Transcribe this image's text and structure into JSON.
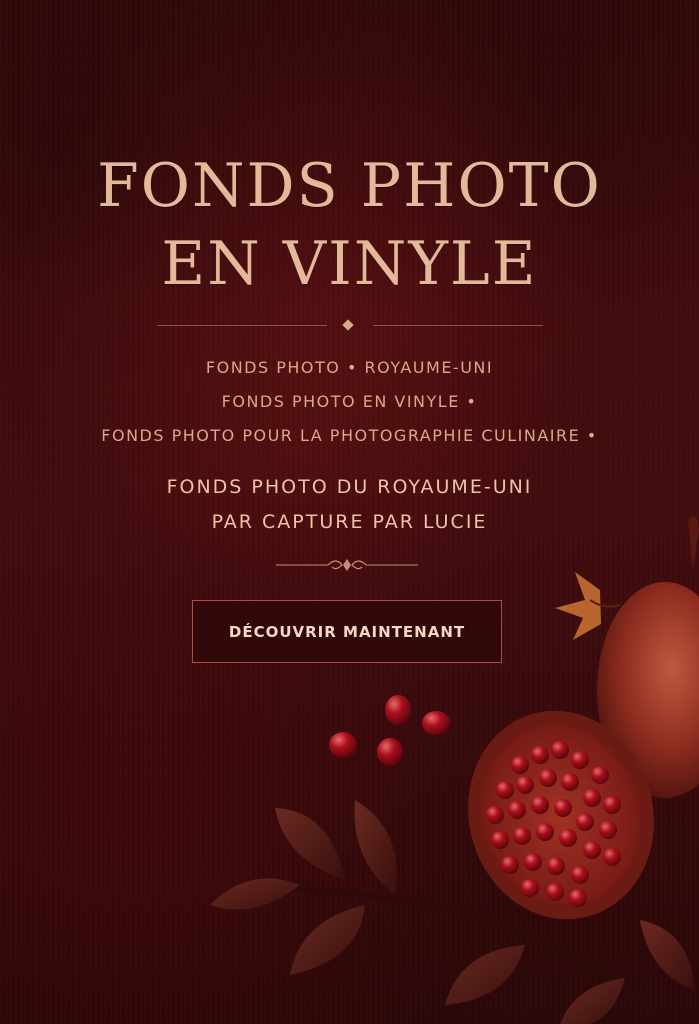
{
  "hero": {
    "title_line1": "FONDS PHOTO",
    "title_line2": "EN VINYLE",
    "subtitle_lines": [
      "FONDS PHOTO • ROYAUME-UNI",
      "FONDS PHOTO EN VINYLE •",
      "FONDS PHOTO POUR LA PHOTOGRAPHIE CULINAIRE •"
    ],
    "tagline_line1": "FONDS PHOTO DU ROYAUME-UNI",
    "tagline_line2": "PAR CAPTURE PAR LUCIE",
    "cta_label": "DÉCOUVRIR MAINTENANT"
  },
  "colors": {
    "background": "#3a0a0c",
    "title": "#e3b999",
    "subtitle": "#d9a98b",
    "tagline": "#ecc4a6",
    "button_border": "#a8523f",
    "button_text": "#f3d8c5"
  },
  "decorations": {
    "divider": "diamond-divider",
    "flourish": "ornament-flourish",
    "photo": "pomegranate-still-life-image"
  }
}
